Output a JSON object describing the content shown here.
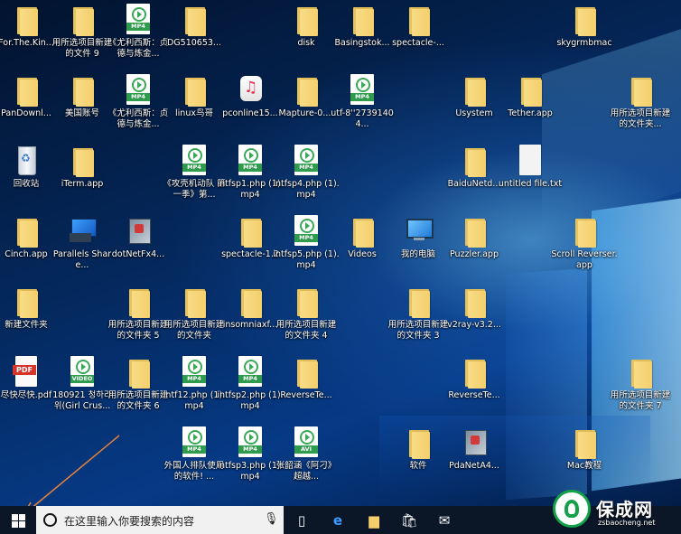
{
  "desktop": {
    "icons": [
      {
        "label": "For.The.Kin...",
        "type": "folder",
        "col": 0,
        "row": 0
      },
      {
        "label": "用所选项目新建的文件 9",
        "type": "folder",
        "col": 1,
        "row": 0
      },
      {
        "label": "《尤利西斯：贞德与炼金...",
        "type": "media",
        "tag": "MP4",
        "col": 2,
        "row": 0
      },
      {
        "label": "DG510653...",
        "type": "folder",
        "col": 3,
        "row": 0
      },
      {
        "label": "disk",
        "type": "folder",
        "col": 5,
        "row": 0
      },
      {
        "label": "Basingstok...",
        "type": "folder",
        "col": 6,
        "row": 0
      },
      {
        "label": "spectacle-...",
        "type": "folder",
        "col": 7,
        "row": 0
      },
      {
        "label": "skygrmbmac",
        "type": "folder",
        "col": 10,
        "row": 0
      },
      {
        "label": "PanDownl...",
        "type": "folder",
        "col": 0,
        "row": 1
      },
      {
        "label": "美国账号",
        "type": "folder",
        "col": 1,
        "row": 1
      },
      {
        "label": "《尤利西斯：贞德与炼金...",
        "type": "media",
        "tag": "MP4",
        "col": 2,
        "row": 1
      },
      {
        "label": "linux鸟哥",
        "type": "folder",
        "col": 3,
        "row": 1
      },
      {
        "label": "pconline15...",
        "type": "music",
        "col": 4,
        "row": 1
      },
      {
        "label": "Mapture-0....",
        "type": "folder",
        "col": 5,
        "row": 1
      },
      {
        "label": "utf-8''27391404...",
        "type": "media",
        "tag": "MP4",
        "col": 6,
        "row": 1
      },
      {
        "label": "Usystem",
        "type": "folder",
        "col": 8,
        "row": 1
      },
      {
        "label": "Tether.app",
        "type": "folder",
        "col": 9,
        "row": 1
      },
      {
        "label": "用所选项目新建的文件夹...",
        "type": "folder",
        "col": 11,
        "row": 1
      },
      {
        "label": "回收站",
        "type": "bin",
        "col": 0,
        "row": 2
      },
      {
        "label": "iTerm.app",
        "type": "folder",
        "col": 1,
        "row": 2
      },
      {
        "label": "《攻壳机动队 第一季》第...",
        "type": "media",
        "tag": "MP4",
        "col": 3,
        "row": 2
      },
      {
        "label": "intfsp1.php (1).mp4",
        "type": "media",
        "tag": "MP4",
        "col": 4,
        "row": 2
      },
      {
        "label": "intfsp4.php (1).mp4",
        "type": "media",
        "tag": "MP4",
        "col": 5,
        "row": 2
      },
      {
        "label": "BaiduNetd...",
        "type": "folder",
        "col": 8,
        "row": 2
      },
      {
        "label": "untitled file.txt",
        "type": "txt",
        "col": 9,
        "row": 2
      },
      {
        "label": "Cinch.app",
        "type": "folder",
        "col": 0,
        "row": 3
      },
      {
        "label": "Parallels Share...",
        "type": "parallels",
        "col": 1,
        "row": 3
      },
      {
        "label": "dotNetFx4...",
        "type": "pkg",
        "col": 2,
        "row": 3
      },
      {
        "label": "spectacle-1.2",
        "type": "folder",
        "col": 4,
        "row": 3
      },
      {
        "label": "intfsp5.php (1).mp4",
        "type": "media",
        "tag": "MP4",
        "col": 5,
        "row": 3
      },
      {
        "label": "Videos",
        "type": "folder",
        "col": 6,
        "row": 3
      },
      {
        "label": "我的电脑",
        "type": "pc",
        "col": 7,
        "row": 3
      },
      {
        "label": "Puzzler.app",
        "type": "folder",
        "col": 8,
        "row": 3
      },
      {
        "label": "Scroll Reverser.app",
        "type": "folder",
        "col": 10,
        "row": 3
      },
      {
        "label": "新建文件夹",
        "type": "folder",
        "col": 0,
        "row": 4
      },
      {
        "label": "用所选项目新建的文件夹 5",
        "type": "folder",
        "col": 2,
        "row": 4
      },
      {
        "label": "用所选项目新建的文件夹",
        "type": "folder",
        "col": 3,
        "row": 4
      },
      {
        "label": "insomniaxf...",
        "type": "folder",
        "col": 4,
        "row": 4
      },
      {
        "label": "用所选项目新建的文件夹 4",
        "type": "folder",
        "col": 5,
        "row": 4
      },
      {
        "label": "用所选项目新建的文件夹 3",
        "type": "folder",
        "col": 7,
        "row": 4
      },
      {
        "label": "v2ray-v3.2...",
        "type": "folder",
        "col": 8,
        "row": 4
      },
      {
        "label": "尽快尽快.pdf",
        "type": "pdf",
        "col": 0,
        "row": 5
      },
      {
        "label": "180921 청하라 위(Girl Crus...",
        "type": "media",
        "tag": "VIDEO",
        "col": 1,
        "row": 5
      },
      {
        "label": "用所选项目新建的文件夹 6",
        "type": "folder",
        "col": 2,
        "row": 5
      },
      {
        "label": "intf12.php (1).mp4",
        "type": "media",
        "tag": "MP4",
        "col": 3,
        "row": 5
      },
      {
        "label": "intfsp2.php (1).mp4",
        "type": "media",
        "tag": "MP4",
        "col": 4,
        "row": 5
      },
      {
        "label": "ReverseTe...",
        "type": "folder",
        "col": 5,
        "row": 5
      },
      {
        "label": "ReverseTe...",
        "type": "folder",
        "col": 8,
        "row": 5
      },
      {
        "label": "用所选项目新建的文件夹 7",
        "type": "folder",
        "col": 11,
        "row": 5
      },
      {
        "label": "外国人排队使用的软件! ...",
        "type": "media",
        "tag": "MP4",
        "col": 3,
        "row": 6
      },
      {
        "label": "intfsp3.php (1).mp4",
        "type": "media",
        "tag": "MP4",
        "col": 4,
        "row": 6
      },
      {
        "label": "张韶涵《阿刁》超越...",
        "type": "media",
        "tag": "AVI",
        "col": 5,
        "row": 6
      },
      {
        "label": "软件",
        "type": "folder",
        "col": 7,
        "row": 6
      },
      {
        "label": "PdaNetA4...",
        "type": "pkg",
        "col": 8,
        "row": 6
      },
      {
        "label": "Mac教程",
        "type": "folder",
        "col": 10,
        "row": 6
      }
    ]
  },
  "taskbar": {
    "search_placeholder": "在这里输入你要搜索的内容",
    "icons": [
      "task-view-icon",
      "edge-browser-icon",
      "file-explorer-icon",
      "store-icon",
      "mail-icon"
    ]
  },
  "watermark": {
    "title": "保成网",
    "url": "zsbaocheng.net"
  },
  "colors": {
    "folder": "#f4cf6c",
    "media_green": "#2e9b4d",
    "taskbar": "#0b1626",
    "search_box": "#f1f1f1",
    "arrow": "#e8823a",
    "brand_green": "#15a04a"
  }
}
